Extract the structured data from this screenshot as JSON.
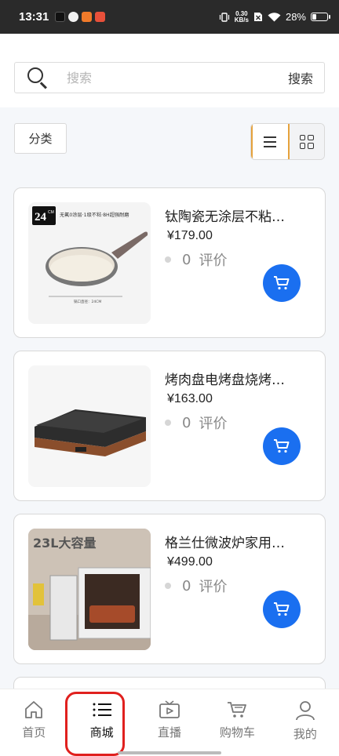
{
  "status_bar": {
    "time": "13:31",
    "speed_value": "0.30",
    "speed_unit": "KB/s",
    "battery": "28%",
    "battery_level": 0.28
  },
  "search": {
    "placeholder": "搜索",
    "button_label": "搜索"
  },
  "toolbar": {
    "category_label": "分类",
    "view_mode": "list"
  },
  "products": [
    {
      "title": "钛陶瓷无涂层不粘…",
      "price": "¥179.00",
      "rating_count": "0",
      "rating_label": "评价",
      "image_caption": "无氟0涂层·1级不粘·8H超强耐磨",
      "image_badge": "24",
      "image_badge_unit": "CM",
      "image_note": "锅口直径：24CM"
    },
    {
      "title": "烤肉盘电烤盘烧烤…",
      "price": "¥163.00",
      "rating_count": "0",
      "rating_label": "评价"
    },
    {
      "title": "格兰仕微波炉家用…",
      "price": "¥499.00",
      "rating_count": "0",
      "rating_label": "评价",
      "image_caption": "23L大容量"
    }
  ],
  "bottom_nav": [
    {
      "label": "首页",
      "icon": "home-icon"
    },
    {
      "label": "商城",
      "icon": "list-icon",
      "active": true
    },
    {
      "label": "直播",
      "icon": "tv-icon"
    },
    {
      "label": "购物车",
      "icon": "cart-icon"
    },
    {
      "label": "我的",
      "icon": "user-icon"
    }
  ],
  "colors": {
    "accent_blue": "#1a6ff0",
    "toggle_border": "#e6a23c",
    "highlight_red": "#e0201e"
  }
}
